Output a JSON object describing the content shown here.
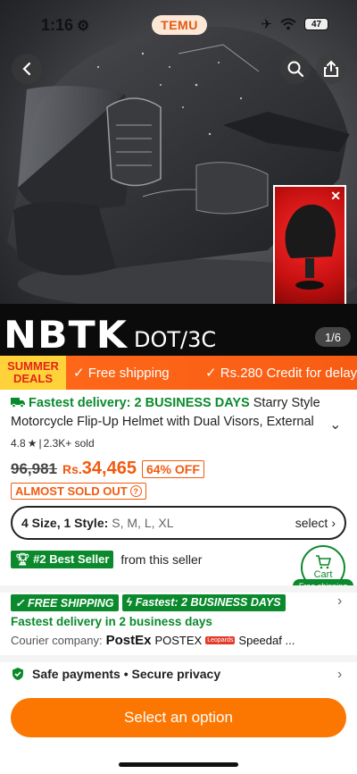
{
  "status_bar": {
    "time": "1:16",
    "app_pill": "TEMU",
    "battery": "47"
  },
  "hero": {
    "brand": "NBTK",
    "brand_sub": "DOT/3C",
    "image_counter": "1/6"
  },
  "promo": {
    "summer_line1": "SUMMER",
    "summer_line2": "DEALS",
    "free_shipping": "Free shipping",
    "credit": "Rs.280 Credit for delay"
  },
  "product": {
    "fast_delivery": "Fastest delivery: 2 BUSINESS DAYS",
    "title": "Starry Style Motorcycle Flip-Up Helmet with Dual Visors, External",
    "rating": "4.8",
    "sold": "2.3K+ sold",
    "old_price": "96,981",
    "currency": "Rs.",
    "price": "34,465",
    "discount": "64% OFF",
    "stock_status": "ALMOST SOLD OUT"
  },
  "options": {
    "summary": "4 Size, 1 Style:",
    "values": "S, M, L, XL",
    "select_label": "select"
  },
  "seller": {
    "badge": "#2 Best Seller",
    "text": "from this seller"
  },
  "cart_float": {
    "label": "Cart",
    "free": "Free shipping"
  },
  "shipping": {
    "badge1": "FREE SHIPPING",
    "badge2": "Fastest: 2 BUSINESS DAYS",
    "fast_line": "Fastest delivery in 2 business days",
    "courier_label": "Courier company:",
    "courier1": "PostEx",
    "courier2": "POSTEX",
    "courier3_logo": "Leopards",
    "courier4": "Speedaf ..."
  },
  "security": {
    "text": "Safe payments • Secure privacy"
  },
  "cta": {
    "label": "Select an option"
  },
  "colors": {
    "accent": "#fb7701",
    "green": "#0a8a2c",
    "price": "#f25a0f"
  }
}
